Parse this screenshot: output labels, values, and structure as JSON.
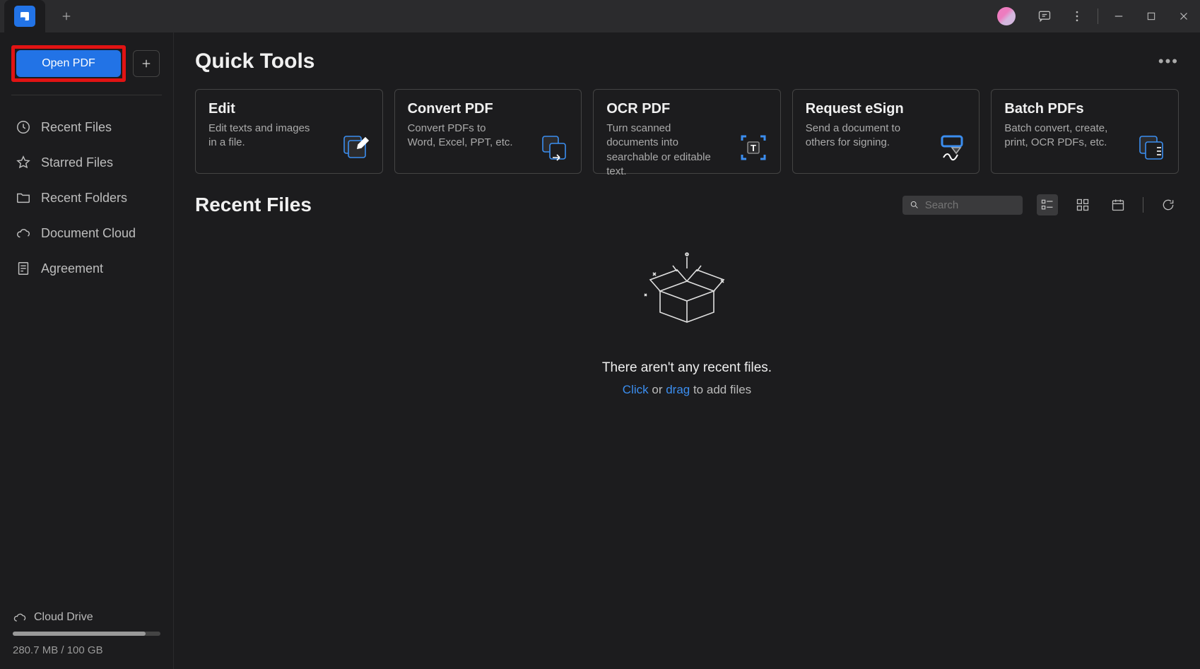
{
  "titlebar": {},
  "sidebar": {
    "open_label": "Open PDF",
    "items": [
      {
        "label": "Recent Files"
      },
      {
        "label": "Starred Files"
      },
      {
        "label": "Recent Folders"
      },
      {
        "label": "Document Cloud"
      },
      {
        "label": "Agreement"
      }
    ],
    "cloud_label": "Cloud Drive",
    "cloud_usage": "280.7 MB / 100 GB"
  },
  "quick_tools": {
    "heading": "Quick Tools",
    "cards": [
      {
        "title": "Edit",
        "desc": "Edit texts and images in a file."
      },
      {
        "title": "Convert PDF",
        "desc": "Convert PDFs to Word, Excel, PPT, etc."
      },
      {
        "title": "OCR PDF",
        "desc": "Turn scanned documents into searchable or editable text."
      },
      {
        "title": "Request eSign",
        "desc": "Send a document to others for signing."
      },
      {
        "title": "Batch PDFs",
        "desc": "Batch convert, create, print, OCR PDFs, etc."
      }
    ]
  },
  "recent": {
    "heading": "Recent Files",
    "search_placeholder": "Search",
    "empty_msg": "There aren't any recent files.",
    "click_label": "Click",
    "or_label": " or ",
    "drag_label": "drag",
    "suffix_label": " to add files"
  }
}
